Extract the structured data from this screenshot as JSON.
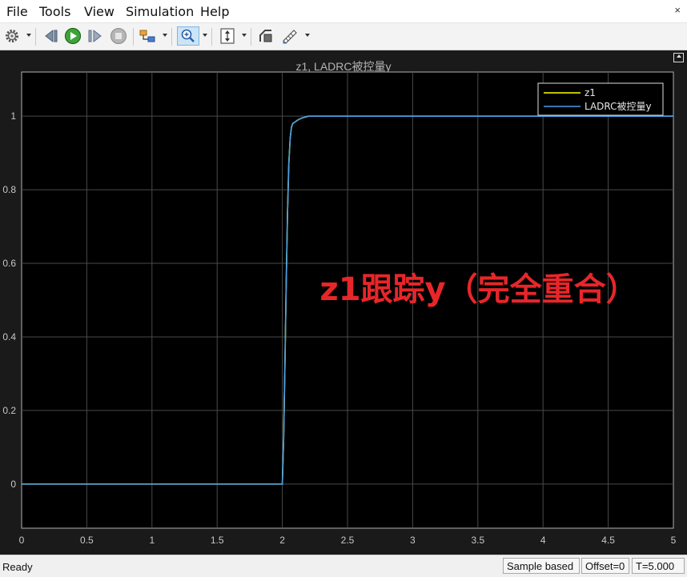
{
  "menu": [
    "File",
    "Tools",
    "View",
    "Simulation",
    "Help"
  ],
  "window_close_glyph": "×",
  "toolbar_icons": [
    "settings-icon",
    "step-back-icon",
    "run-icon",
    "step-forward-icon",
    "stop-icon",
    "highlight-model-icon",
    "zoom-icon",
    "autoscale-icon",
    "style-icon",
    "signal-selector-icon"
  ],
  "figure": {
    "title": "z1, LADRC被控量y",
    "annotation": "z1跟踪y（完全重合）",
    "annotation_color": "#e8262a",
    "background": "#000000",
    "grid_color": "#4a4a4a"
  },
  "chart_data": {
    "type": "line",
    "title": "z1, LADRC被控量y",
    "xlabel": "",
    "ylabel": "",
    "xlim": [
      0,
      5
    ],
    "ylim": [
      -0.12,
      1.12
    ],
    "x_ticks": [
      "0",
      "0.5",
      "1",
      "1.5",
      "2",
      "2.5",
      "3",
      "3.5",
      "4",
      "4.5",
      "5"
    ],
    "y_ticks": [
      "0",
      "0.2",
      "0.4",
      "0.6",
      "0.8",
      "1"
    ],
    "grid": true,
    "legend_position": "top-right",
    "series": [
      {
        "name": "z1",
        "color": "#ffff00",
        "x": [
          0,
          2.0,
          2.01,
          2.02,
          2.03,
          2.04,
          2.05,
          2.06,
          2.07,
          2.08,
          2.1,
          2.12,
          2.15,
          2.2,
          2.3,
          5
        ],
        "y": [
          0,
          0,
          0.12,
          0.33,
          0.55,
          0.74,
          0.87,
          0.94,
          0.97,
          0.98,
          0.985,
          0.99,
          0.995,
          1.0,
          1.0,
          1.0
        ]
      },
      {
        "name": "LADRC被控量y",
        "color": "#4a9ee8",
        "x": [
          0,
          2.0,
          2.01,
          2.02,
          2.03,
          2.04,
          2.05,
          2.06,
          2.07,
          2.08,
          2.1,
          2.12,
          2.15,
          2.2,
          2.3,
          5
        ],
        "y": [
          0,
          0,
          0.12,
          0.33,
          0.55,
          0.74,
          0.87,
          0.94,
          0.97,
          0.98,
          0.985,
          0.99,
          0.995,
          1.0,
          1.0,
          1.0
        ]
      }
    ]
  },
  "status": {
    "left": "Ready",
    "fields": [
      "Sample based",
      "Offset=0",
      "T=5.000"
    ]
  }
}
